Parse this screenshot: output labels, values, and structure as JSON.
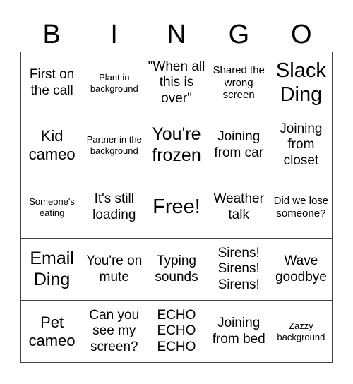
{
  "header": {
    "letters": [
      "B",
      "I",
      "N",
      "G",
      "O"
    ]
  },
  "cells": [
    "First on the call",
    "Plant in background",
    "\"When all this is over\"",
    "Shared the wrong screen",
    "Slack Ding",
    "Kid cameo",
    "Partner in the background",
    "You're frozen",
    "Joining from car",
    "Joining from closet",
    "Someone's eating",
    "It's still loading",
    "Free!",
    "Weather talk",
    "Did we lose someone?",
    "Email Ding",
    "You're on mute",
    "Typing sounds",
    "Sirens! Sirens! Sirens!",
    "Wave goodbye",
    "Pet cameo",
    "Can you see my screen?",
    "ECHO ECHO ECHO",
    "Joining from bed",
    "Zazzy background"
  ]
}
